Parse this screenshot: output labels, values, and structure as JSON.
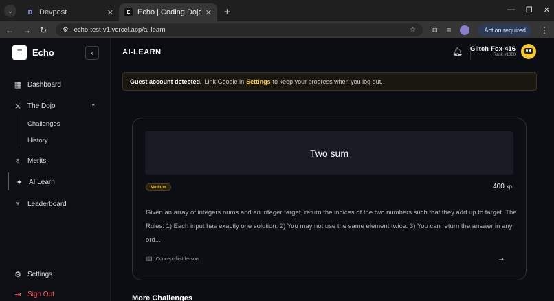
{
  "browser": {
    "tabs": [
      {
        "favicon": "D",
        "title": "Devpost",
        "active": false
      },
      {
        "favicon": "E",
        "title": "Echo | Coding Dojo and C",
        "active": true
      }
    ],
    "url": "echo-test-v1.vercel.app/ai-learn",
    "action_required": "Action required"
  },
  "sidebar": {
    "brand": "Echo",
    "items": [
      {
        "label": "Dashboard",
        "icon": "grid-icon"
      },
      {
        "label": "The Dojo",
        "icon": "sword-icon"
      },
      {
        "label": "Merits",
        "icon": "medal-icon"
      },
      {
        "label": "AI Learn",
        "icon": "sparkle-icon"
      },
      {
        "label": "Leaderboard",
        "icon": "trophy-icon"
      }
    ],
    "dojo_sub": [
      "Challenges",
      "History"
    ],
    "settings": "Settings",
    "signout": "Sign Out"
  },
  "header": {
    "title": "AI-LEARN",
    "user_name": "Glitch-Fox-416",
    "user_rank": "Rank #1000"
  },
  "banner": {
    "bold": "Guest account detected.",
    "pre": "Link Google in",
    "link": "Settings",
    "post": "to keep your progress when you log out."
  },
  "challenge": {
    "title": "Two sum",
    "difficulty": "Medium",
    "xp_value": "400",
    "xp_unit": "xp",
    "description": "Given an array of integers nums and an integer target, return the indices of the two numbers such that they add up to target. The Rules: 1) Each input has exactly one solution. 2) You may not use the same element twice. 3) You can return the answer in any ord...",
    "footer": "Concept-first lesson"
  },
  "more_title": "More Challenges"
}
